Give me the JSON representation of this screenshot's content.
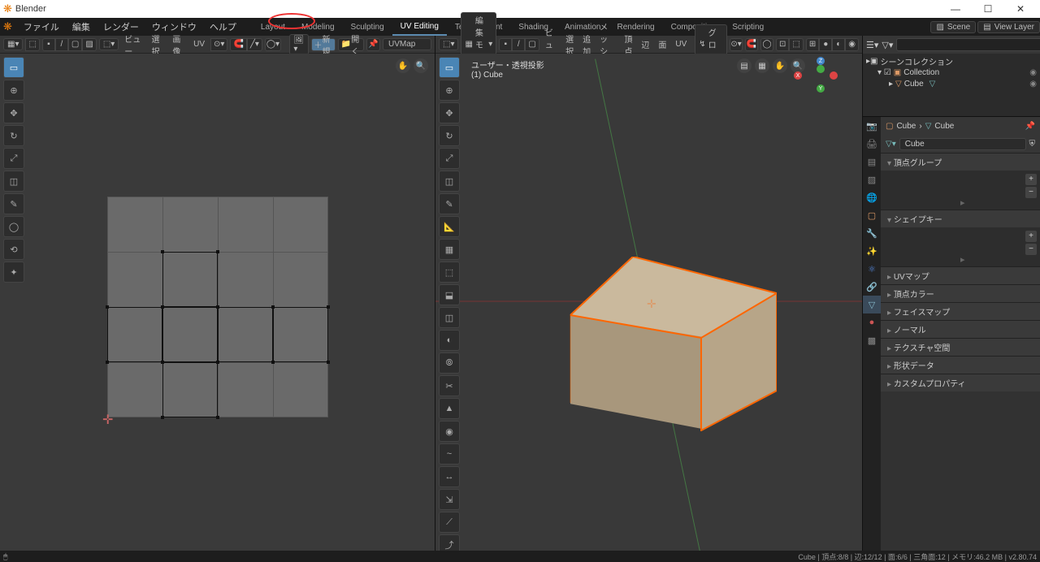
{
  "app": {
    "title": "Blender"
  },
  "window_buttons": {
    "min": "—",
    "max": "☐",
    "close": "✕"
  },
  "topmenu": {
    "items": [
      "ファイル",
      "編集",
      "レンダー",
      "ウィンドウ",
      "ヘルプ"
    ],
    "workspaces": [
      "Layout",
      "Modeling",
      "Sculpting",
      "UV Editing",
      "Texture Paint",
      "Shading",
      "Animation",
      "Rendering",
      "Compositing",
      "Scripting"
    ],
    "active_workspace": "UV Editing",
    "scene_label": "Scene",
    "viewlayer_label": "View Layer"
  },
  "uv_header": {
    "menus": [
      "ビュー",
      "選択",
      "画像",
      "UV"
    ],
    "new": "新規",
    "open": "開く",
    "uvmap": "UVMap"
  },
  "view3d_header": {
    "mode": "編集モード",
    "menus": [
      "ビュー",
      "選択",
      "追加",
      "メッシュ",
      "頂点",
      "辺",
      "面",
      "UV"
    ],
    "orientation": "グロー..."
  },
  "view3d_overlay": {
    "line1": "ユーザー・透視投影",
    "line2": "(1) Cube"
  },
  "outliner": {
    "search_placeholder": "",
    "scene_collection": "シーンコレクション",
    "collection": "Collection",
    "object": "Cube"
  },
  "properties": {
    "breadcrumb1": "Cube",
    "breadcrumb2": "Cube",
    "name_field": "Cube",
    "sections": [
      "頂点グループ",
      "シェイプキー",
      "UVマップ",
      "頂点カラー",
      "フェイスマップ",
      "ノーマル",
      "テクスチャ空間",
      "形状データ",
      "カスタムプロパティ"
    ]
  },
  "status": {
    "left": "",
    "right": "Cube | 頂点:8/8 | 辺:12/12 | 面:6/6 | 三角面:12 | メモリ:46.2 MB | v2.80.74"
  },
  "icons": {
    "blender": "❋",
    "scene": "▨",
    "viewlayer": "▤",
    "hand": "✋",
    "zoom": "🔍",
    "camera": "📷",
    "grid": "▦",
    "collection": "▣",
    "mesh": "▽",
    "eye": "◉"
  },
  "tools_uv": [
    "select-box",
    "cursor",
    "move",
    "rotate",
    "scale",
    "transform",
    "annotate",
    "measure",
    "grab",
    "relax",
    "pinch"
  ],
  "tool_glyphs_uv": [
    "▭",
    "⊕",
    "✥",
    "↻",
    "⤢",
    "◫",
    "✎",
    "◯",
    "⟲",
    "✦"
  ],
  "tools_3d": [
    "select-box",
    "cursor",
    "move",
    "rotate",
    "scale",
    "transform",
    "annotate",
    "measure",
    "add-cube",
    "extrude-region",
    "extrude-normals",
    "inset",
    "bevel",
    "loop-cut",
    "knife",
    "poly-build",
    "spin",
    "smooth",
    "edge-slide",
    "shrink",
    "shear",
    "rip"
  ],
  "tool_glyphs_3d": [
    "▭",
    "⊕",
    "✥",
    "↻",
    "⤢",
    "◫",
    "✎",
    "📐",
    "▦",
    "⬚",
    "⬓",
    "◫",
    "◐",
    "⦾",
    "✂",
    "▲",
    "◉",
    "~",
    "↔",
    "⇲",
    "⟋",
    "⤴"
  ]
}
